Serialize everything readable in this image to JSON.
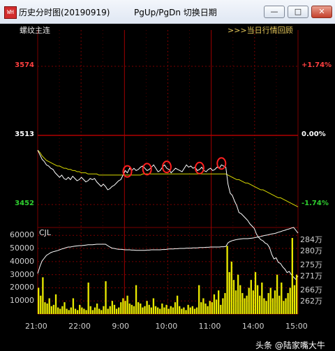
{
  "window": {
    "title": "历史分时图(20190919)",
    "page_hint": "PgUp/PgDn  切换日期",
    "icon_text": "WH",
    "buttons": {
      "minimize": "—",
      "maximize": "□",
      "close": "✕"
    }
  },
  "panel": {
    "instrument": "螺纹主连",
    "review_link": ">>>当日行情回顾"
  },
  "colors": {
    "up": "#ff4040",
    "down": "#2fd02f",
    "neutral": "#ffffff",
    "grid": "#7a0000",
    "price_line": "#ffffff",
    "avg_line": "#d9d900",
    "volume": "#e8e800",
    "position_line": "#ffffff",
    "highlight": "#ff2020"
  },
  "chart_data": [
    {
      "type": "line",
      "price_axis": {
        "ticks": [
          3574,
          3513,
          3452
        ],
        "colors": [
          "up",
          "neutral",
          "down"
        ]
      },
      "pct_axis": {
        "ticks": [
          "+1.74%",
          "0.00%",
          "-1.74%"
        ]
      },
      "ylim": [
        3433,
        3606
      ],
      "x_sessions": [
        "21:00",
        "22:00",
        "9:00",
        "10:00",
        "11:00",
        "14:00",
        "15:00"
      ],
      "series": [
        {
          "key": "price",
          "values": [
            3500,
            3496,
            3492,
            3490,
            3487,
            3486,
            3484,
            3483,
            3480,
            3478,
            3476,
            3478,
            3475,
            3474,
            3476,
            3474,
            3477,
            3475,
            3473,
            3474,
            3476,
            3474,
            3472,
            3473,
            3475,
            3474,
            3475,
            3472,
            3470,
            3468,
            3470,
            3468,
            3465,
            3466,
            3468,
            3469,
            3471,
            3473,
            3474,
            3478,
            3482,
            3480,
            3484,
            3482,
            3484,
            3482,
            3483,
            3485,
            3486,
            3484,
            3482,
            3483,
            3485,
            3487,
            3484,
            3481,
            3482,
            3485,
            3487,
            3484,
            3483,
            3480,
            3482,
            3484,
            3483,
            3482,
            3481,
            3484,
            3487,
            3485,
            3486,
            3484,
            3485,
            3482,
            3483,
            3485,
            3482,
            3481,
            3483,
            3484,
            3482,
            3483,
            3485,
            3484,
            3487,
            3486,
            3485,
            3470,
            3462,
            3460,
            3455,
            3451,
            3445,
            3444,
            3442,
            3440,
            3438,
            3435,
            3433,
            3431,
            3426,
            3423,
            3421,
            3420,
            3418,
            3417,
            3414,
            3408,
            3404,
            3405,
            3401,
            3400,
            3397,
            3395,
            3392,
            3393,
            3390,
            3388,
            3386,
            3389
          ]
        },
        {
          "key": "average",
          "values": [
            3500,
            3498,
            3495,
            3493,
            3491,
            3490,
            3489,
            3488,
            3487,
            3486,
            3486,
            3485,
            3484,
            3484,
            3483,
            3483,
            3482,
            3482,
            3481,
            3481,
            3480,
            3480,
            3480,
            3479,
            3479,
            3479,
            3479,
            3479,
            3478,
            3478,
            3478,
            3478,
            3478,
            3478,
            3478,
            3478,
            3478,
            3478,
            3478,
            3478,
            3478,
            3478,
            3478,
            3478,
            3478,
            3478,
            3478,
            3478,
            3479,
            3479,
            3479,
            3479,
            3479,
            3479,
            3479,
            3479,
            3479,
            3479,
            3479,
            3479,
            3479,
            3479,
            3479,
            3479,
            3479,
            3479,
            3479,
            3479,
            3479,
            3479,
            3479,
            3479,
            3479,
            3479,
            3479,
            3479,
            3479,
            3479,
            3479,
            3479,
            3479,
            3479,
            3479,
            3479,
            3479,
            3479,
            3479,
            3478,
            3477,
            3476,
            3475,
            3474,
            3474,
            3473,
            3472,
            3471,
            3471,
            3470,
            3469,
            3468,
            3467,
            3466,
            3465,
            3465,
            3464,
            3463,
            3462,
            3461,
            3460,
            3459,
            3458,
            3458,
            3457,
            3456,
            3455,
            3454,
            3453,
            3452,
            3451,
            3450
          ]
        }
      ],
      "highlights": [
        {
          "t": 41
        },
        {
          "t": 50
        },
        {
          "t": 59
        },
        {
          "t": 74
        },
        {
          "t": 84
        }
      ]
    },
    {
      "type": "bar",
      "title": "CJL",
      "volume_axis": {
        "ticks": [
          60000,
          50000,
          40000,
          30000,
          20000,
          10000
        ],
        "max": 66000
      },
      "position_axis": {
        "ticks": [
          "284万",
          "280万",
          "275万",
          "271万",
          "266万",
          "262万"
        ],
        "range_wan": [
          257,
          288
        ]
      },
      "volume": [
        20000,
        14000,
        28000,
        9000,
        8000,
        12000,
        6000,
        7000,
        15000,
        5000,
        4000,
        6000,
        9000,
        4000,
        3000,
        5000,
        12000,
        4000,
        3000,
        7000,
        5000,
        4000,
        3000,
        24000,
        6000,
        3000,
        5000,
        8000,
        4000,
        3000,
        6000,
        25000,
        4000,
        6000,
        10000,
        7000,
        4000,
        5000,
        9000,
        12000,
        10000,
        14000,
        8000,
        7000,
        6000,
        22000,
        9000,
        8000,
        5000,
        6000,
        10000,
        7000,
        5000,
        12000,
        6000,
        5000,
        4000,
        8000,
        5000,
        7000,
        4000,
        6000,
        5000,
        9000,
        14000,
        6000,
        4000,
        5000,
        3000,
        7000,
        5000,
        6000,
        4000,
        5000,
        22000,
        9000,
        12000,
        8000,
        6000,
        10000,
        9000,
        15000,
        11000,
        18000,
        7000,
        12000,
        16000,
        52000,
        32000,
        40000,
        26000,
        18000,
        30000,
        22000,
        16000,
        12000,
        14000,
        20000,
        26000,
        18000,
        32000,
        22000,
        14000,
        24000,
        12000,
        10000,
        16000,
        20000,
        12000,
        18000,
        30000,
        14000,
        24000,
        10000,
        12000,
        16000,
        20000,
        58000,
        22000,
        30000
      ],
      "position_wan": [
        271.5,
        274,
        276,
        277,
        278,
        278.5,
        279,
        279.3,
        279.5,
        279.7,
        280,
        280.3,
        280.5,
        280.8,
        281,
        281,
        281.2,
        281.3,
        281.4,
        281.5,
        281.5,
        281.6,
        281.7,
        281.8,
        281.8,
        281.8,
        281.9,
        282,
        282,
        282,
        282,
        282,
        281.5,
        281,
        280.6,
        280.5,
        280.3,
        280.2,
        280.2,
        280.1,
        280,
        280,
        280,
        279.9,
        279.9,
        279.8,
        279.8,
        279.8,
        279.8,
        279.8,
        279.9,
        279.9,
        280,
        280,
        280,
        280,
        280,
        280.1,
        280.1,
        280.2,
        280.3,
        280.3,
        280.3,
        280.4,
        280.4,
        280.5,
        280.5,
        280.5,
        280.6,
        280.6,
        280.6,
        280.7,
        280.7,
        280.7,
        280.8,
        280.8,
        280.8,
        280.9,
        280.9,
        281,
        281,
        281,
        281,
        281,
        281.1,
        281.1,
        281.2,
        282.5,
        283,
        283.3,
        283.5,
        283.7,
        283.8,
        283.9,
        284,
        284,
        284,
        284.1,
        284.2,
        284.3,
        284.5,
        284.6,
        284.8,
        285,
        285.2,
        285.3,
        285.5,
        285.7,
        285.8,
        286,
        286.3,
        286.5,
        286.8,
        287,
        287.3,
        287.5,
        287.8,
        288,
        287,
        286
      ]
    }
  ],
  "watermark": "头条 @陆家嘴大牛"
}
